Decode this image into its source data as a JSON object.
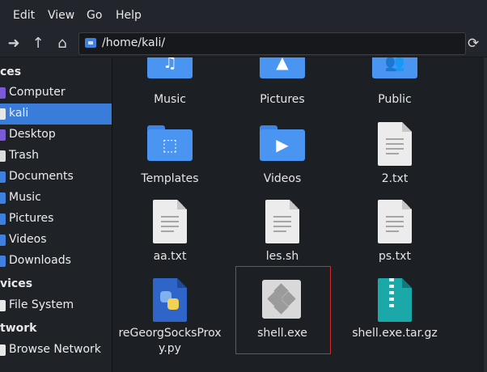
{
  "menu": [
    "Edit",
    "View",
    "Go",
    "Help"
  ],
  "path": "/home/kali/",
  "sidebar": {
    "heads": [
      "ces",
      "vices",
      "twork"
    ],
    "items": [
      {
        "label": "Computer",
        "color": "#7a5ad6"
      },
      {
        "label": "kali",
        "color": "#e8e8e8"
      },
      {
        "label": "Desktop",
        "color": "#7a5ad6"
      },
      {
        "label": "Trash",
        "color": "#dcdcdc"
      },
      {
        "label": "Documents",
        "color": "#3f7fe0"
      },
      {
        "label": "Music",
        "color": "#3f7fe0"
      },
      {
        "label": "Pictures",
        "color": "#3f7fe0"
      },
      {
        "label": "Videos",
        "color": "#3f7fe0"
      },
      {
        "label": "Downloads",
        "color": "#3f7fe0"
      },
      {
        "label": "File System",
        "color": "#e8e8e8"
      },
      {
        "label": "Browse Network",
        "color": "#e8e8e8"
      }
    ]
  },
  "files": [
    {
      "name": "Music",
      "kind": "folder",
      "glyph": "♫"
    },
    {
      "name": "Pictures",
      "kind": "folder",
      "glyph": "▲"
    },
    {
      "name": "Public",
      "kind": "folder",
      "glyph": "👥"
    },
    {
      "name": "Templates",
      "kind": "folder",
      "glyph": "⬚"
    },
    {
      "name": "Videos",
      "kind": "folder",
      "glyph": "▶"
    },
    {
      "name": "2.txt",
      "kind": "doc"
    },
    {
      "name": "aa.txt",
      "kind": "doc"
    },
    {
      "name": "les.sh",
      "kind": "doc"
    },
    {
      "name": "ps.txt",
      "kind": "doc"
    },
    {
      "name_lines": [
        "reGeorgSocksProx",
        "y.py"
      ],
      "kind": "python"
    },
    {
      "name": "shell.exe",
      "kind": "exe"
    },
    {
      "name": "shell.exe.tar.gz",
      "kind": "archive"
    }
  ]
}
